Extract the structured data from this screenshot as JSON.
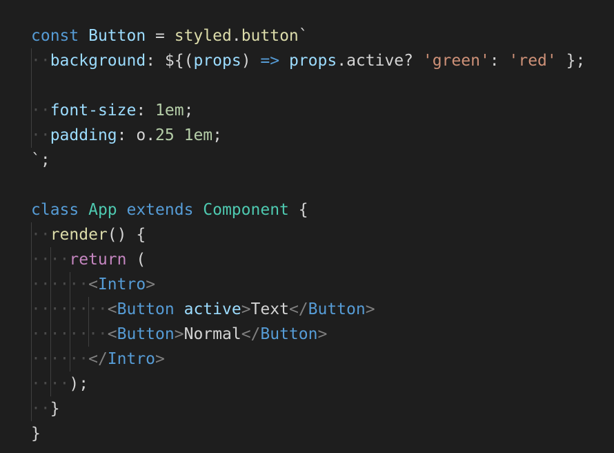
{
  "editor": {
    "lines": [
      {
        "tokens": [
          {
            "c": "kw",
            "t": "const "
          },
          {
            "c": "var",
            "t": "Button"
          },
          {
            "c": "pun",
            "t": " = "
          },
          {
            "c": "fn",
            "t": "styled"
          },
          {
            "c": "pun",
            "t": "."
          },
          {
            "c": "fn",
            "t": "button"
          },
          {
            "c": "pun",
            "t": "`"
          }
        ],
        "guides": []
      },
      {
        "tokens": [
          {
            "c": "ws",
            "t": "··"
          },
          {
            "c": "var",
            "t": "background"
          },
          {
            "c": "pun",
            "t": ": ${("
          },
          {
            "c": "var",
            "t": "props"
          },
          {
            "c": "pun",
            "t": ") "
          },
          {
            "c": "kw",
            "t": "=>"
          },
          {
            "c": "pun",
            "t": " "
          },
          {
            "c": "var",
            "t": "props"
          },
          {
            "c": "pun",
            "t": "."
          },
          {
            "c": "dim",
            "t": "active"
          },
          {
            "c": "pun",
            "t": "? "
          },
          {
            "c": "str",
            "t": "'green'"
          },
          {
            "c": "pun",
            "t": ": "
          },
          {
            "c": "str",
            "t": "'red'"
          },
          {
            "c": "pun",
            "t": " };"
          }
        ],
        "guides": [
          0
        ]
      },
      {
        "tokens": [],
        "guides": [
          0
        ]
      },
      {
        "tokens": [
          {
            "c": "ws",
            "t": "··"
          },
          {
            "c": "var",
            "t": "font-size"
          },
          {
            "c": "pun",
            "t": ": "
          },
          {
            "c": "num",
            "t": "1em"
          },
          {
            "c": "pun",
            "t": ";"
          }
        ],
        "guides": [
          0
        ]
      },
      {
        "tokens": [
          {
            "c": "ws",
            "t": "··"
          },
          {
            "c": "var",
            "t": "padding"
          },
          {
            "c": "pun",
            "t": ": "
          },
          {
            "c": "dim",
            "t": "o."
          },
          {
            "c": "num",
            "t": "25"
          },
          {
            "c": "pun",
            "t": " "
          },
          {
            "c": "num",
            "t": "1em"
          },
          {
            "c": "pun",
            "t": ";"
          }
        ],
        "guides": [
          0
        ]
      },
      {
        "tokens": [
          {
            "c": "pun",
            "t": "`;"
          }
        ],
        "guides": []
      },
      {
        "tokens": [],
        "guides": []
      },
      {
        "tokens": [
          {
            "c": "kw",
            "t": "class "
          },
          {
            "c": "cls",
            "t": "App"
          },
          {
            "c": "kw",
            "t": " extends "
          },
          {
            "c": "cls",
            "t": "Component"
          },
          {
            "c": "pun",
            "t": " {"
          }
        ],
        "guides": []
      },
      {
        "tokens": [
          {
            "c": "ws",
            "t": "··"
          },
          {
            "c": "fn",
            "t": "render"
          },
          {
            "c": "pun",
            "t": "() {"
          }
        ],
        "guides": [
          0
        ]
      },
      {
        "tokens": [
          {
            "c": "ws",
            "t": "····"
          },
          {
            "c": "ctl",
            "t": "return"
          },
          {
            "c": "pun",
            "t": " ("
          }
        ],
        "guides": [
          0,
          2
        ]
      },
      {
        "tokens": [
          {
            "c": "ws",
            "t": "······"
          },
          {
            "c": "tagp",
            "t": "<"
          },
          {
            "c": "tag",
            "t": "Intro"
          },
          {
            "c": "tagp",
            "t": ">"
          }
        ],
        "guides": [
          0,
          2,
          4
        ]
      },
      {
        "tokens": [
          {
            "c": "ws",
            "t": "········"
          },
          {
            "c": "tagp",
            "t": "<"
          },
          {
            "c": "tag",
            "t": "Button"
          },
          {
            "c": "pun",
            "t": " "
          },
          {
            "c": "attr",
            "t": "active"
          },
          {
            "c": "tagp",
            "t": ">"
          },
          {
            "c": "txt",
            "t": "Text"
          },
          {
            "c": "tagp",
            "t": "</"
          },
          {
            "c": "tag",
            "t": "Button"
          },
          {
            "c": "tagp",
            "t": ">"
          }
        ],
        "guides": [
          0,
          2,
          4,
          6
        ]
      },
      {
        "tokens": [
          {
            "c": "ws",
            "t": "········"
          },
          {
            "c": "tagp",
            "t": "<"
          },
          {
            "c": "tag",
            "t": "Button"
          },
          {
            "c": "tagp",
            "t": ">"
          },
          {
            "c": "txt",
            "t": "Normal"
          },
          {
            "c": "tagp",
            "t": "</"
          },
          {
            "c": "tag",
            "t": "Button"
          },
          {
            "c": "tagp",
            "t": ">"
          }
        ],
        "guides": [
          0,
          2,
          4,
          6
        ]
      },
      {
        "tokens": [
          {
            "c": "ws",
            "t": "······"
          },
          {
            "c": "tagp",
            "t": "</"
          },
          {
            "c": "tag",
            "t": "Intro"
          },
          {
            "c": "tagp",
            "t": ">"
          }
        ],
        "guides": [
          0,
          2,
          4
        ]
      },
      {
        "tokens": [
          {
            "c": "ws",
            "t": "····"
          },
          {
            "c": "pun",
            "t": ");"
          }
        ],
        "guides": [
          0,
          2
        ]
      },
      {
        "tokens": [
          {
            "c": "ws",
            "t": "··"
          },
          {
            "c": "pun",
            "t": "}"
          }
        ],
        "guides": [
          0
        ]
      },
      {
        "tokens": [
          {
            "c": "pun",
            "t": "}"
          }
        ],
        "guides": []
      }
    ]
  },
  "colors": {
    "background": "#1e1e1e",
    "keyword": "#569cd6",
    "control": "#c586c0",
    "function": "#dcdcaa",
    "variable": "#9cdcfe",
    "class": "#4ec9b0",
    "string": "#ce9178",
    "number": "#b5cea8",
    "tag_punctuation": "#808080"
  }
}
